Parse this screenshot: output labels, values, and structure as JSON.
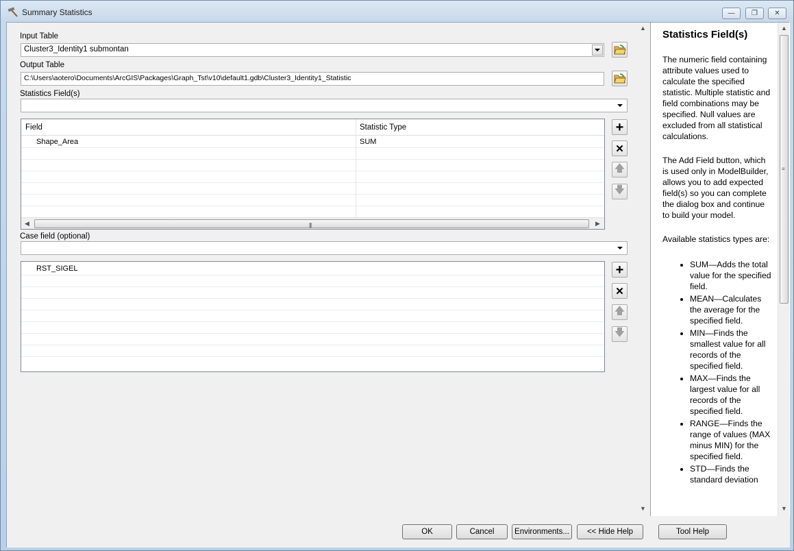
{
  "window": {
    "title": "Summary Statistics",
    "controls": {
      "minimize": "minimize-icon",
      "maximize": "maximize-icon",
      "close": "close-icon"
    }
  },
  "form": {
    "input_table": {
      "label": "Input Table",
      "value": "Cluster3_Identity1 submontan"
    },
    "output_table": {
      "label": "Output Table",
      "value": "C:\\Users\\aotero\\Documents\\ArcGIS\\Packages\\Graph_Tst\\v10\\default1.gdb\\Cluster3_Identity1_Statistic"
    },
    "statistics_fields": {
      "label": "Statistics Field(s)",
      "value": "",
      "columns": [
        "Field",
        "Statistic Type"
      ],
      "rows": [
        {
          "field": "Shape_Area",
          "stat": "SUM"
        }
      ]
    },
    "case_field": {
      "label": "Case field (optional)",
      "value": "",
      "rows": [
        "RST_SIGEL"
      ]
    }
  },
  "help": {
    "title": "Statistics Field(s)",
    "para1": "The numeric field containing attribute values used to calculate the specified statistic. Multiple statistic and field combinations may be specified. Null values are excluded from all statistical calculations.",
    "para2": "The Add Field button, which is used only in ModelBuilder, allows you to add expected field(s) so you can complete the dialog box and continue to build your model.",
    "para3": "Available statistics types are:",
    "items": [
      "SUM—Adds the total value for the specified field.",
      "MEAN—Calculates the average for the specified field.",
      "MIN—Finds the smallest value for all records of the specified field.",
      "MAX—Finds the largest value for all records of the specified field.",
      "RANGE—Finds the range of values (MAX minus MIN) for the specified field.",
      "STD—Finds the standard deviation"
    ]
  },
  "buttons": {
    "ok": "OK",
    "cancel": "Cancel",
    "environments": "Environments...",
    "hide_help": "<< Hide Help",
    "tool_help": "Tool Help"
  }
}
